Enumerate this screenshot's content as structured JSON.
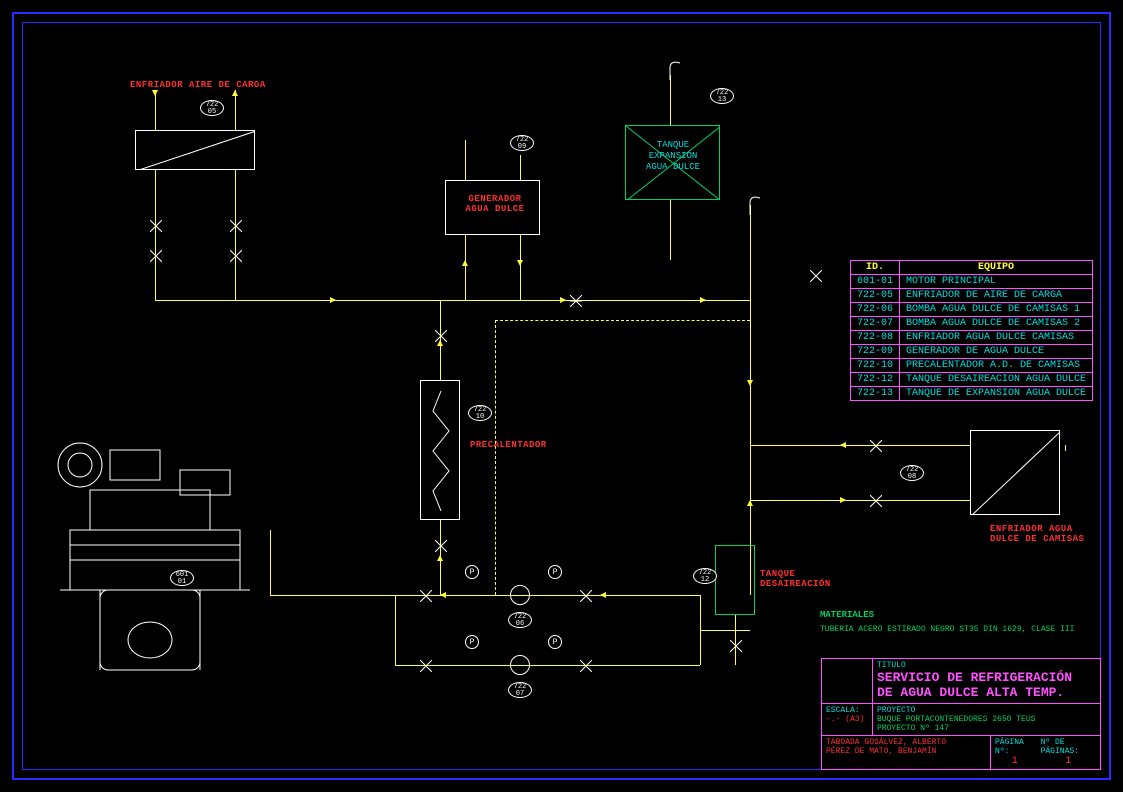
{
  "labels": {
    "enfriador_aire": "ENFRIADOR AIRE DE CARGA",
    "generador_agua": "GENERADOR\nAGUA DULCE",
    "tanque_exp": "TANQUE\nEXPANSIÓN\nAGUA DULCE",
    "precalentador": "PRECALENTADOR",
    "tanque_desair": "TANQUE\nDESAIREACIÓN",
    "enfriador_camisas": "ENFRIADOR AGUA\nDULCE DE CAMISAS",
    "materiales_hdr": "MATERIALES",
    "materiales_txt": "TUBERIA ACERO ESTIRADO NEGRO ST35 DIN 1629, CLASE III"
  },
  "tags": {
    "t601_01": "601\n01",
    "t722_05": "722\n05",
    "t722_06": "722\n06",
    "t722_07": "722\n07",
    "t722_08": "722\n08",
    "t722_09": "722\n09",
    "t722_10": "722\n10",
    "t722_12": "722\n12",
    "t722_13": "722\n13",
    "p": "P"
  },
  "equip_table": {
    "headers": [
      "ID.",
      "EQUIPO"
    ],
    "rows": [
      [
        "601-01",
        "MOTOR PRINCIPAL"
      ],
      [
        "722-05",
        "ENFRIADOR DE AIRE DE CARGA"
      ],
      [
        "722-06",
        "BOMBA AGUA DULCE DE CAMISAS 1"
      ],
      [
        "722-07",
        "BOMBA AGUA DULCE DE CAMISAS 2"
      ],
      [
        "722-08",
        "ENFRIADOR AGUA DULCE CAMISAS"
      ],
      [
        "722-09",
        "GENERADOR DE AGUA DULCE"
      ],
      [
        "722-10",
        "PRECALENTADOR A.D. DE CAMISAS"
      ],
      [
        "722-12",
        "TANQUE DESAIREACION AGUA DULCE"
      ],
      [
        "722-13",
        "TANQUE DE EXPANSION AGUA DULCE"
      ]
    ]
  },
  "title_block": {
    "titulo_lbl": "TITULO",
    "titulo": "SERVICIO DE REFRIGERACIÓN\nDE AGUA DULCE ALTA TEMP.",
    "escala_lbl": "ESCALA:",
    "escala": "-.- (A3)",
    "proyecto_lbl": "PROYECTO",
    "proyecto": "BUQUE PORTACONTENEDORES 2650 TEUS\nPROYECTO Nº 147",
    "autores": "TABOADA GOSÁLVEZ, ALBERTO\nPÉREZ DE MATO, BENJAMÍN",
    "pagina_lbl": "PÁGINA Nº:",
    "pagina": "1",
    "npag_lbl": "Nº DE PÁGINAS:",
    "npag": "1"
  }
}
